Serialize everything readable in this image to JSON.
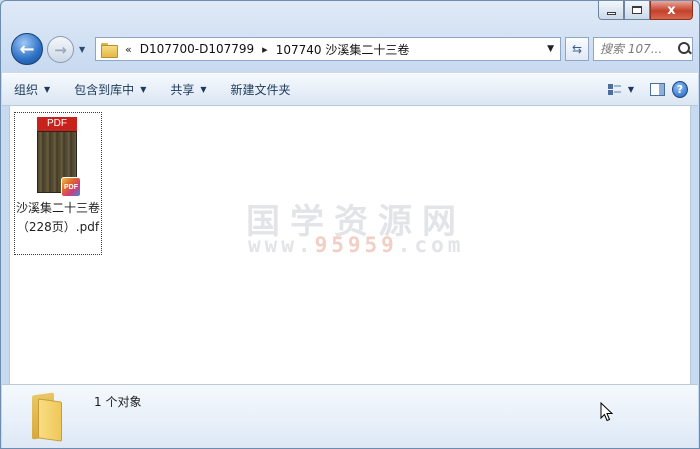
{
  "window": {
    "controls": {
      "close_label": "x"
    }
  },
  "navigation": {
    "back_glyph": "←",
    "forward_glyph": "→",
    "breadcrumb": [
      "D107700-D107799",
      "107740 沙溪集二十三卷"
    ],
    "overflow_glyph": "«",
    "search_placeholder": "搜索 107..."
  },
  "toolbar": {
    "organize": "组织",
    "include_in_library": "包含到库中",
    "share": "共享",
    "new_folder": "新建文件夹",
    "help_glyph": "?"
  },
  "content": {
    "files": [
      {
        "name": "沙溪集二十三卷（228页）.pdf",
        "type_label": "PDF",
        "badge": "PDF"
      }
    ],
    "watermark_cn": "国学资源网",
    "watermark_url_prefix": "www.",
    "watermark_url_number": "95959",
    "watermark_url_suffix": ".com"
  },
  "details": {
    "object_count": "1 个对象"
  },
  "colors": {
    "accent": "#2c6fc4",
    "close_red": "#c4412a",
    "pdf_red": "#c8221c"
  }
}
